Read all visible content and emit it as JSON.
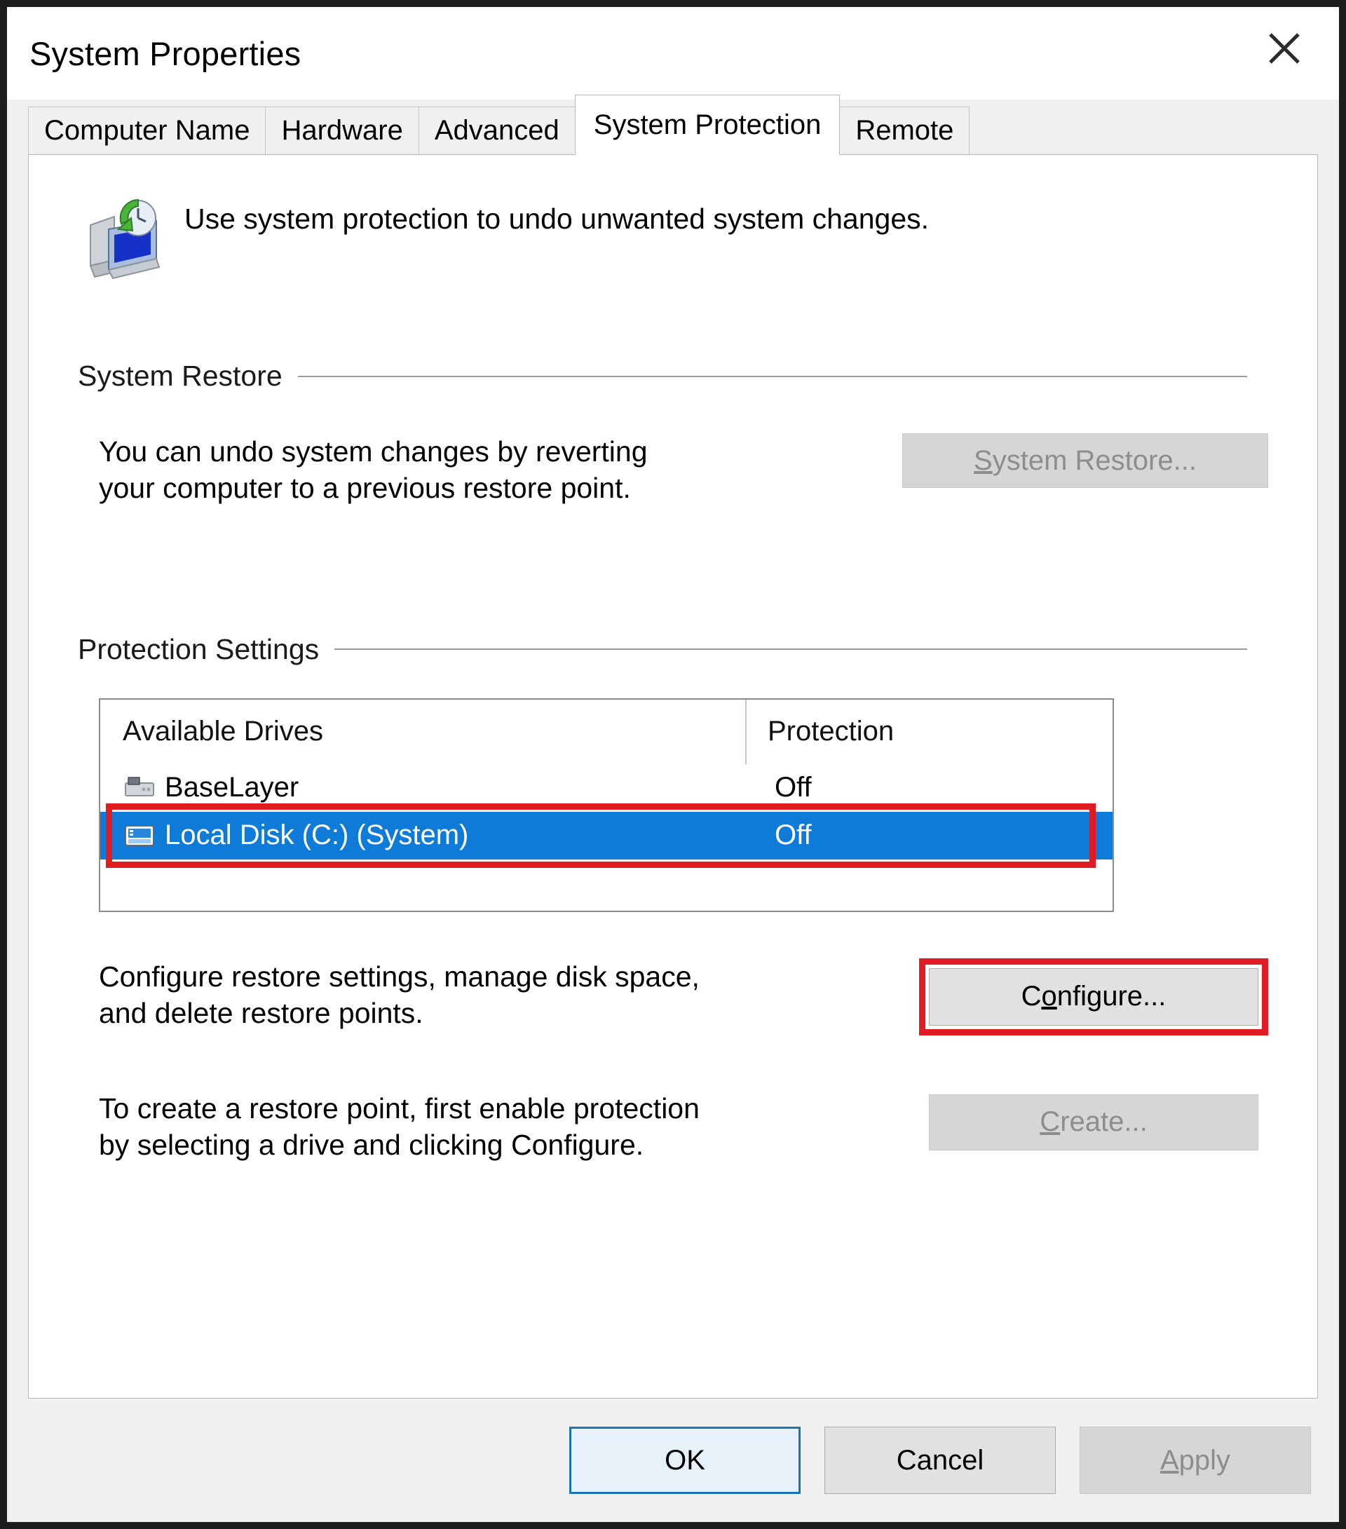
{
  "window": {
    "title": "System Properties",
    "close_icon": "close-icon"
  },
  "tabs": [
    {
      "label": "Computer Name",
      "active": false
    },
    {
      "label": "Hardware",
      "active": false
    },
    {
      "label": "Advanced",
      "active": false
    },
    {
      "label": "System Protection",
      "active": true
    },
    {
      "label": "Remote",
      "active": false
    }
  ],
  "intro": {
    "icon": "system-protection-icon",
    "text": "Use system protection to undo unwanted system changes."
  },
  "system_restore": {
    "group_title": "System Restore",
    "description_line1": "You can undo system changes by reverting",
    "description_line2": "your computer to a previous restore point.",
    "button": {
      "label": "System Restore...",
      "accelerator": "S",
      "enabled": false
    }
  },
  "protection_settings": {
    "group_title": "Protection Settings",
    "columns": [
      "Available Drives",
      "Protection"
    ],
    "rows": [
      {
        "icon": "hard-drive-icon",
        "name": "BaseLayer",
        "protection": "Off",
        "selected": false,
        "annotated": false
      },
      {
        "icon": "system-drive-icon",
        "name": "Local Disk  (C:) (System)",
        "protection": "Off",
        "selected": true,
        "annotated": true
      }
    ],
    "configure": {
      "description_line1": "Configure restore settings, manage disk space,",
      "description_line2": "and delete restore points.",
      "button": {
        "label": "Configure...",
        "accelerator": "o",
        "enabled": true,
        "annotated": true
      }
    },
    "create": {
      "description_line1": "To create a restore point, first enable protection",
      "description_line2": "by selecting a drive and clicking Configure.",
      "button": {
        "label": "Create...",
        "accelerator": "C",
        "enabled": false
      }
    }
  },
  "footer": {
    "ok": "OK",
    "cancel": "Cancel",
    "apply": "Apply",
    "apply_accelerator": "A"
  },
  "colors": {
    "selection_blue": "#0f7bd8",
    "annotation_red": "#e01b22",
    "default_button_border": "#1b74b3",
    "window_bg": "#f0f0f0",
    "panel_bg": "#ffffff"
  }
}
